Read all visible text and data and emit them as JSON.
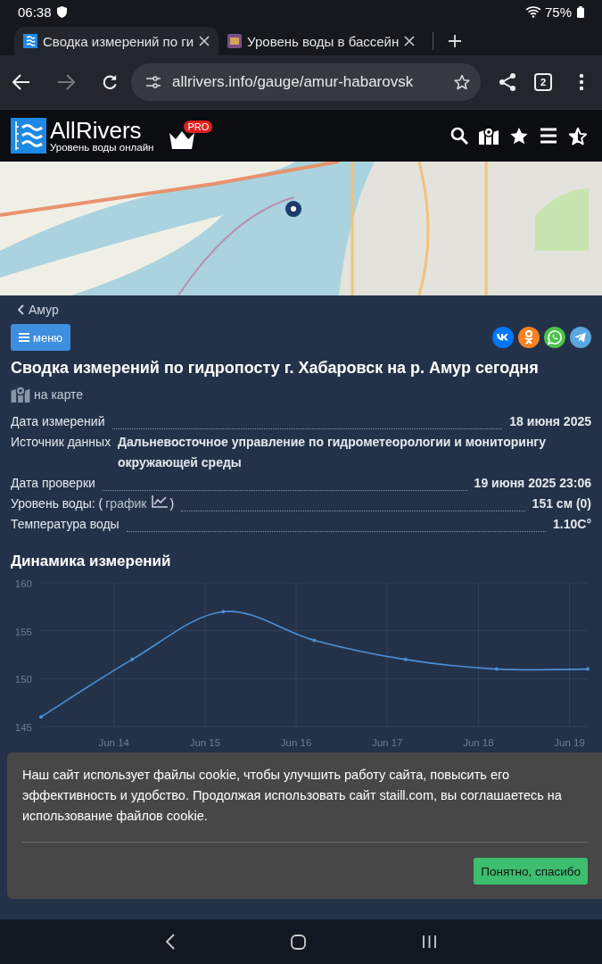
{
  "status_bar": {
    "time": "06:38",
    "battery": "75%"
  },
  "tabs": [
    {
      "title": "Сводка измерений по ги",
      "selected": true
    },
    {
      "title": "Уровень воды в бассейн",
      "selected": false
    }
  ],
  "address_bar": {
    "url": "allrivers.info/gauge/amur-habarovsk",
    "tab_count": "2"
  },
  "site_header": {
    "logo": "AllRivers",
    "tagline": "Уровень воды онлайн",
    "badge": "PRO"
  },
  "breadcrumb": "Амур",
  "menu_button": "меню",
  "share_buttons": [
    {
      "kind": "vk",
      "color": "#0077ff"
    },
    {
      "kind": "ok",
      "color": "#f58220"
    },
    {
      "kind": "whatsapp",
      "color": "#4cc247"
    },
    {
      "kind": "telegram",
      "color": "#5aa6dd"
    }
  ],
  "title": "Сводка измерений по гидропосту г. Хабаровск на р. Амур сегодня",
  "map_link": "на карте",
  "details": [
    {
      "kind": "leader",
      "label": "Дата измерений",
      "value": "18 июня 2025"
    },
    {
      "kind": "block",
      "label": "Источник данных",
      "value": "Дальневосточное управление по гидрометеорологии и мониторингу окружающей среды"
    },
    {
      "kind": "leader",
      "label": "Дата проверки",
      "value": "19 июня 2025 23:06"
    },
    {
      "kind": "chartlink",
      "label": "Уровень воды: (",
      "link": "график",
      "label_end": ")",
      "value": "151 см (0)"
    },
    {
      "kind": "leader",
      "label": "Температура воды",
      "value": "1.10C°"
    }
  ],
  "chart_heading": "Динамика измерений",
  "chart_data": {
    "type": "line",
    "categories": [
      null,
      "Jun 14",
      "Jun 15",
      "Jun 16",
      "Jun 17",
      "Jun 18",
      "Jun 19"
    ],
    "series": [
      {
        "color": "#4a90d9",
        "values": [
          146,
          152,
          157,
          154,
          152,
          151,
          151
        ]
      }
    ],
    "ylim": [
      145,
      160
    ],
    "grid": true,
    "yticks": [
      145,
      150,
      155,
      160
    ]
  },
  "cookie_notice": {
    "text": "Наш сайт использует файлы cookie, чтобы улучшить работу сайта, повысить его эффективность и удобство. Продолжая использовать сайт staill.com, вы соглашаетесь на использование файлов cookie.",
    "button": "Понятно, спасибо"
  }
}
